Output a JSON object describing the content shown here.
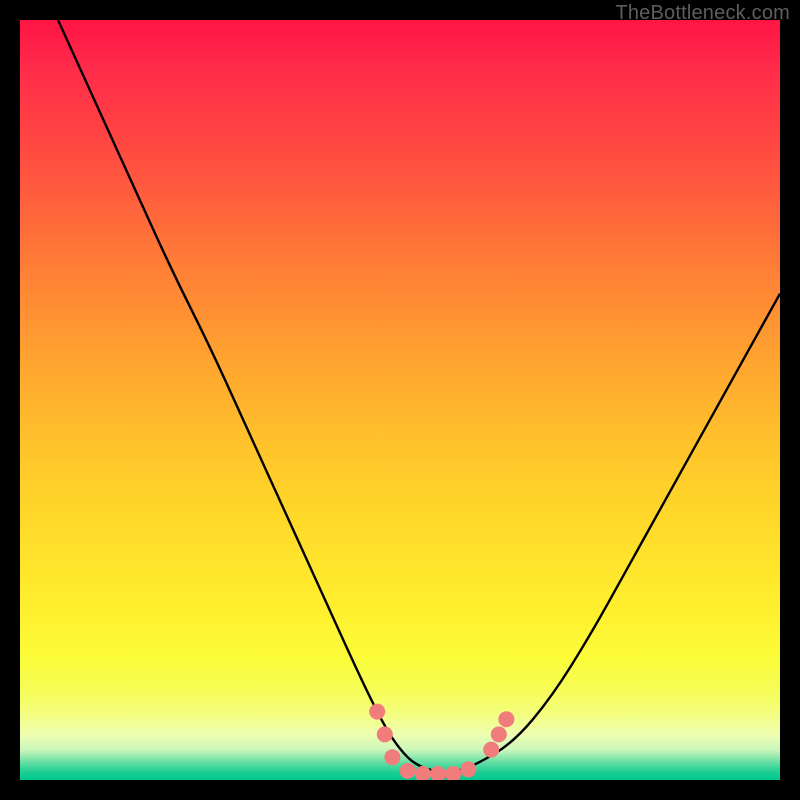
{
  "watermark": "TheBottleneck.com",
  "colors": {
    "background": "#000000",
    "curve": "#000000",
    "marker_fill": "#f07c7c",
    "marker_stroke": "#e86a6a",
    "gradient_top": "#ff1444",
    "gradient_bottom": "#00c88f"
  },
  "chart_data": {
    "type": "line",
    "title": "",
    "xlabel": "",
    "ylabel": "",
    "xlim": [
      0,
      100
    ],
    "ylim": [
      0,
      100
    ],
    "annotations": [],
    "series": [
      {
        "name": "bottleneck-curve",
        "x": [
          5,
          10,
          15,
          20,
          25,
          30,
          35,
          40,
          45,
          48,
          50,
          52,
          55,
          57,
          60,
          65,
          70,
          75,
          80,
          85,
          90,
          95,
          100
        ],
        "y": [
          100,
          89,
          78,
          67,
          57,
          46,
          35,
          24,
          13,
          7,
          4,
          2,
          1,
          1,
          2,
          5,
          11,
          19,
          28,
          37,
          46,
          55,
          64
        ]
      }
    ],
    "markers": [
      {
        "name": "left-marker-1",
        "x": 47,
        "y": 9
      },
      {
        "name": "left-marker-2",
        "x": 48,
        "y": 6
      },
      {
        "name": "left-marker-3",
        "x": 49,
        "y": 3
      },
      {
        "name": "flat-marker-1",
        "x": 51,
        "y": 1.2
      },
      {
        "name": "flat-marker-2",
        "x": 53,
        "y": 0.8
      },
      {
        "name": "flat-marker-3",
        "x": 55,
        "y": 0.8
      },
      {
        "name": "flat-marker-4",
        "x": 57,
        "y": 0.8
      },
      {
        "name": "flat-marker-5",
        "x": 59,
        "y": 1.4
      },
      {
        "name": "right-marker-1",
        "x": 62,
        "y": 4
      },
      {
        "name": "right-marker-2",
        "x": 63,
        "y": 6
      },
      {
        "name": "right-marker-3",
        "x": 64,
        "y": 8
      }
    ]
  }
}
